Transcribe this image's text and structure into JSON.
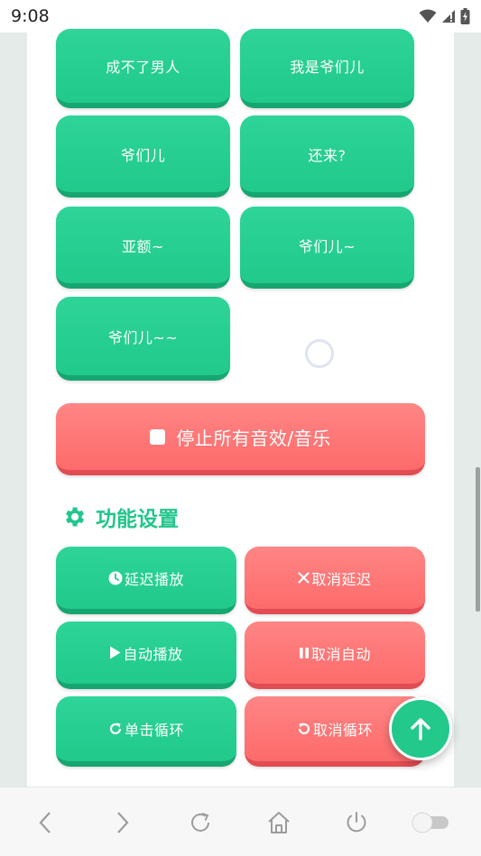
{
  "status_bar": {
    "time": "9:08"
  },
  "sound_buttons": [
    {
      "label": "成不了男人"
    },
    {
      "label": "我是爷们儿"
    },
    {
      "label": "爷们儿"
    },
    {
      "label": "还来?"
    },
    {
      "label": "亚额~"
    },
    {
      "label": "爷们儿~"
    },
    {
      "label": "爷们儿~~"
    }
  ],
  "stop_button": {
    "label": "停止所有音效/音乐"
  },
  "settings": {
    "title": "功能设置",
    "delay_play": "延迟播放",
    "cancel_delay": "取消延迟",
    "auto_play": "自动播放",
    "cancel_auto": "取消自动",
    "single_loop": "单击循环",
    "cancel_loop": "取消循环"
  },
  "colors": {
    "green": "#22c98b",
    "red": "#fd6b6b",
    "white": "#ffffff"
  },
  "icons": {
    "settings": "gear-icon",
    "delay": "clock-icon",
    "cancel_delay": "x-icon",
    "auto": "play-icon",
    "cancel_auto": "pause-icon",
    "loop": "redo-icon",
    "cancel_loop": "undo-icon",
    "fab": "arrow-up-icon"
  }
}
